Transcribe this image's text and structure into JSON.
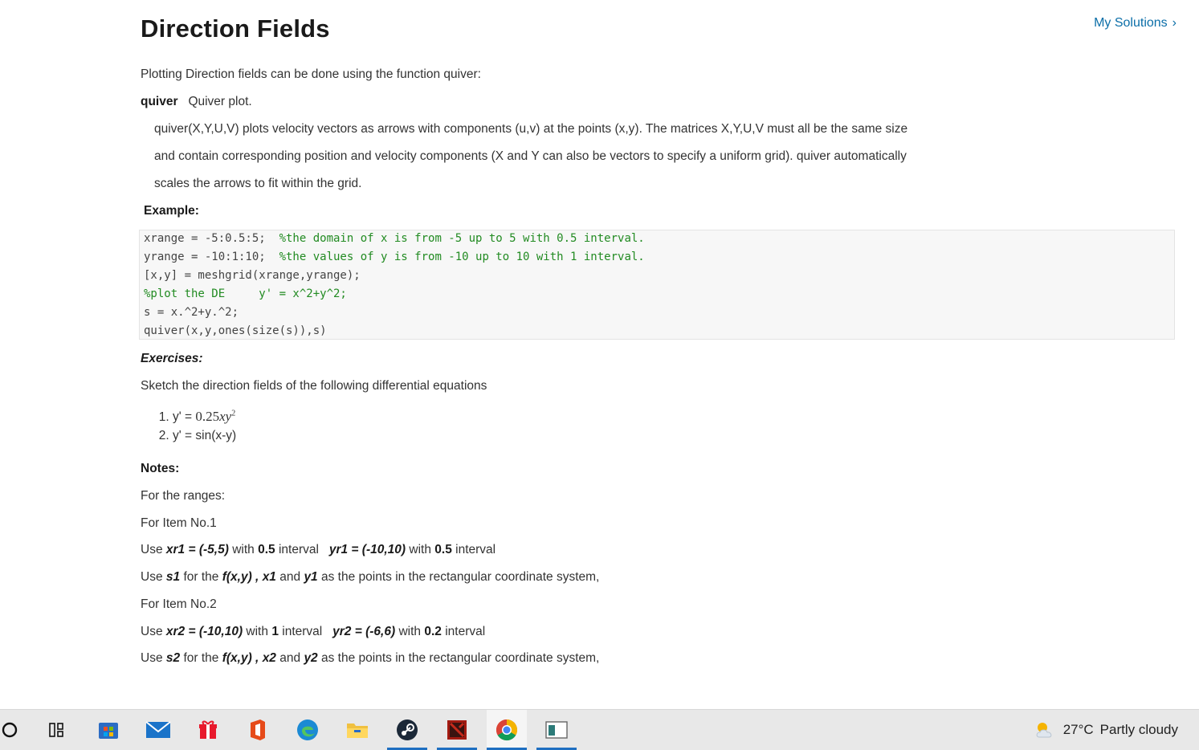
{
  "header": {
    "title": "Direction Fields",
    "my_solutions": "My Solutions",
    "chevron": "›"
  },
  "intro": "Plotting Direction fields can be done using the function quiver:",
  "quiver": {
    "name": "quiver",
    "short": "Quiver plot.",
    "desc1": "quiver(X,Y,U,V) plots velocity vectors as arrows with components (u,v) at the points (x,y).  The matrices X,Y,U,V must all be the same size",
    "desc2": "and contain corresponding position and velocity components (X and Y  can also be vectors to specify a uniform grid).  quiver automatically",
    "desc3": "scales the arrows to fit within the grid."
  },
  "example_heading": "Example:",
  "code": {
    "l1_code": "xrange = -5:0.5:5;  ",
    "l1_comment": "%the domain of x is from -5 up to 5 with 0.5 interval.",
    "l2_code": "yrange = -10:1:10;  ",
    "l2_comment": "%the values of y is from -10 up to 10 with 1 interval.",
    "l3": "[x,y] = meshgrid(xrange,yrange);",
    "l4_comment": "%plot the DE     y' = x^2+y^2;",
    "l5": "s = x.^2+y.^2;",
    "l6": "quiver(x,y,ones(size(s)),s)"
  },
  "exercises_heading": "Exercises:",
  "exercises_intro": "Sketch the direction fields of the following differential equations",
  "exercises": {
    "item1_prefix": "y' = ",
    "item1_coef": "0.25",
    "item1_vars": "xy",
    "item1_exp": "2",
    "item2": "y' = sin(x-y)"
  },
  "notes": {
    "heading": "Notes:",
    "ranges": "For the ranges:",
    "item1_label": "For Item No.1",
    "item1_use": "Use",
    "xr1": "xr1 = (-5,5)",
    "with": "with",
    "v05": "0.5",
    "interval": "interval",
    "yr1": "yr1 = (-10,10)",
    "s1": "s1",
    "for_the": "for the",
    "fxy": "f(x,y) ,",
    "x1": "x1",
    "and": "and",
    "y1": "y1",
    "points_text": "as the points in the rectangular coordinate system,",
    "item2_label": "For Item No.2",
    "xr2": "xr2 = (-10,10)",
    "v1": "1",
    "yr2": "yr2 = (-6,6)",
    "v02": "0.2",
    "s2": "s2",
    "x2": "x2",
    "y2": "y2"
  },
  "taskbar": {
    "weather_temp": "27°C",
    "weather_desc": "Partly cloudy",
    "icons": [
      "cortana-icon",
      "task-view-icon",
      "store-icon",
      "mail-icon",
      "gift-icon",
      "office-icon",
      "edge-icon",
      "file-explorer-icon",
      "steam-icon",
      "dota-icon",
      "chrome-icon",
      "app-window-icon"
    ]
  }
}
